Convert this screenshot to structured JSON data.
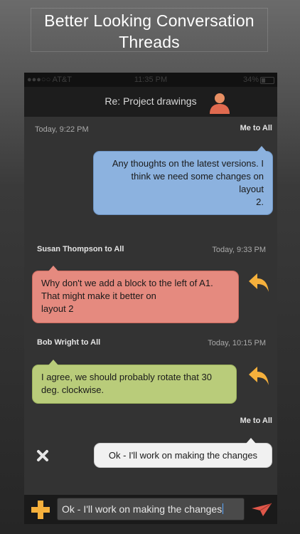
{
  "promo": {
    "title_line1": "Better Looking Conversation",
    "title_line2": "Threads"
  },
  "status_bar": {
    "carrier": "●●●○○ AT&T",
    "time": "11:35 PM",
    "battery": "34%"
  },
  "nav": {
    "title": "Re: Project drawings",
    "avatar_icon": "person-avatar-icon"
  },
  "thread": {
    "messages": [
      {
        "timestamp": "Today, 9:22 PM",
        "sender": "Me to All",
        "lines": [
          "Any thoughts on the latest versions. I",
          "think we need some changes on",
          "layout",
          "2."
        ],
        "color": "#8cb2df"
      },
      {
        "sender": "Susan Thompson to All",
        "timestamp": "Today, 9:33 PM",
        "lines": [
          "Why don't we add a block to the left of A1.",
          "That might make it better on",
          "layout 2"
        ],
        "color": "#e58a7f",
        "reply_icon": "reply-arrow-icon"
      },
      {
        "sender": "Bob Wright to All",
        "timestamp": "Today, 10:15 PM",
        "lines": [
          "I agree, we should probably rotate that 30",
          "deg. clockwise."
        ],
        "color": "#b9cc7a",
        "reply_icon": "reply-arrow-icon"
      },
      {
        "sender": "Me to All",
        "lines": [
          "Ok - I'll work on making the changes"
        ],
        "color": "#f1f1f1"
      }
    ],
    "delete_icon": "close-x-icon"
  },
  "composer": {
    "input_value": "Ok - I'll work on making the changes",
    "add_icon": "plus-icon",
    "send_icon": "paper-plane-icon"
  },
  "colors": {
    "accent_orange": "#f5b03c",
    "send_red": "#e0574a"
  }
}
